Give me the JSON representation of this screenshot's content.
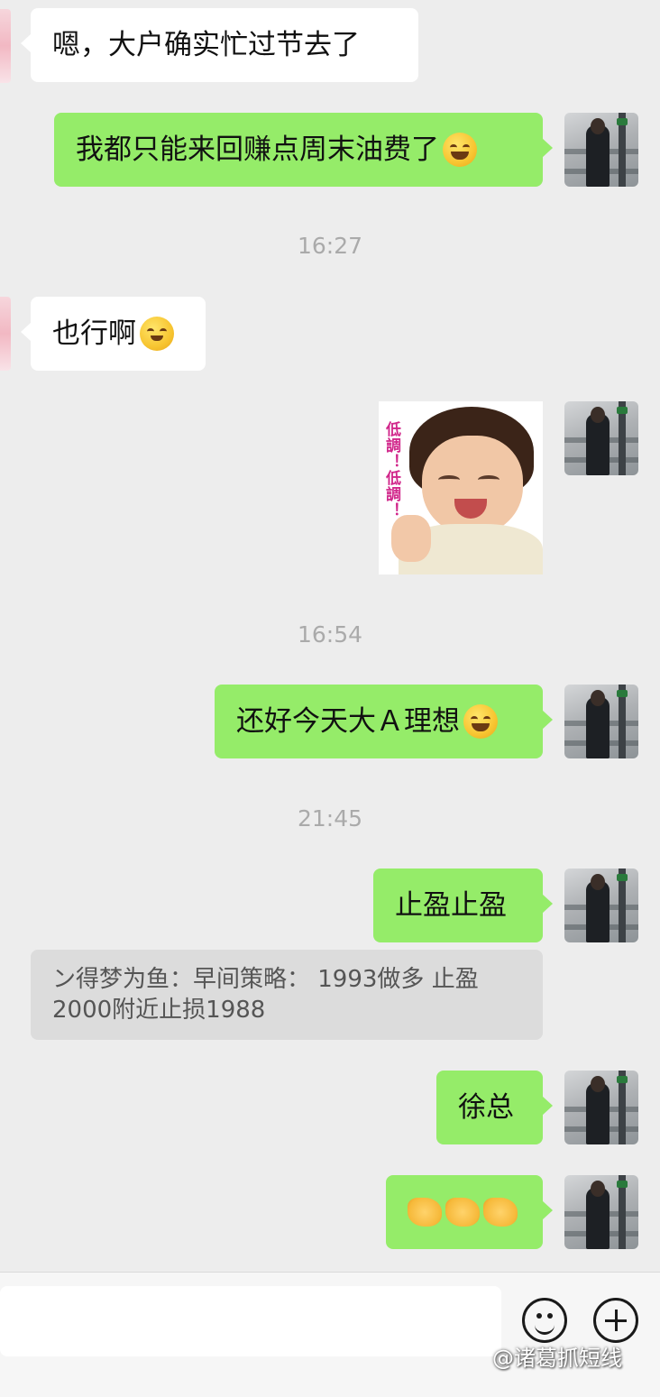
{
  "messages": [
    {
      "id": "m1",
      "side": "in",
      "text": "嗯，大户确实忙过节去了",
      "emoji": ""
    },
    {
      "id": "m2",
      "side": "out",
      "text": "我都只能来回赚点周末油费了",
      "emoji": "laughing-crying"
    },
    {
      "id": "t1",
      "time": "16:27"
    },
    {
      "id": "m3",
      "side": "in",
      "text": "也行啊",
      "emoji": "hand-over-mouth"
    },
    {
      "id": "m4",
      "side": "out",
      "sticker_caption": "低調！低調！"
    },
    {
      "id": "t2",
      "time": "16:54"
    },
    {
      "id": "m5",
      "side": "out",
      "text": "还好今天大Ａ理想",
      "emoji": "laughing-crying"
    },
    {
      "id": "t3",
      "time": "21:45"
    },
    {
      "id": "m6",
      "side": "out",
      "text": "止盈止盈"
    },
    {
      "id": "m6q",
      "quote": "ン得梦为鱼：早间策略： 1993做多  止盈 2000附近止损1988"
    },
    {
      "id": "m7",
      "side": "out",
      "text": "徐总"
    },
    {
      "id": "m8",
      "side": "out",
      "emoji_row": [
        "handshake",
        "handshake",
        "handshake"
      ]
    }
  ],
  "times": {
    "t1": "16:27",
    "t2": "16:54",
    "t3": "21:45"
  },
  "texts": {
    "m1": "嗯，大户确实忙过节去了",
    "m2": "我都只能来回赚点周末油费了",
    "m3": "也行啊",
    "m5": "还好今天大Ａ理想",
    "m6": "止盈止盈",
    "m6q_line1": "ン得梦为鱼：早间策略： 1993做多  止盈",
    "m6q_line2": "2000附近止损1988",
    "m7": "徐总"
  },
  "sticker": {
    "caption": "低調！低調！"
  },
  "input_bar": {
    "emoji_button": "smile-icon",
    "more_button": "plus-icon"
  },
  "watermark": "@诸葛抓短线",
  "colors": {
    "background": "#ededed",
    "outgoing": "#95ec69",
    "incoming": "#ffffff",
    "quote": "#dcdcdc"
  }
}
